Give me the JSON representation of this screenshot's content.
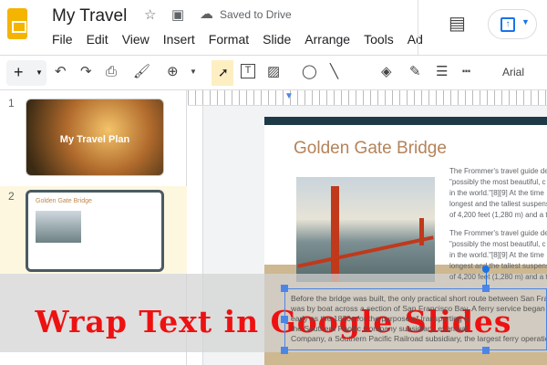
{
  "header": {
    "title": "My Travel",
    "saved_status": "Saved to Drive"
  },
  "menu": [
    "File",
    "Edit",
    "View",
    "Insert",
    "Format",
    "Slide",
    "Arrange",
    "Tools",
    "Ad"
  ],
  "toolbar": {
    "font": "Arial"
  },
  "slides_panel": {
    "items": [
      {
        "number": "1",
        "title": "My Travel Plan"
      },
      {
        "number": "2",
        "title": "Golden Gate Bridge"
      }
    ]
  },
  "slide": {
    "title": "Golden Gate Bridge",
    "para1": [
      "The Frommer's travel guide de",
      "\"possibly the most beautiful, c",
      "in the world.\"[8][9] At the time",
      "longest and the tallest suspens",
      "of 4,200 feet (1,280 m) and a t"
    ],
    "para2": [
      "The Frommer's travel guide de",
      "\"possibly the most beautiful, c",
      "in the world.\"[8][9] At the time",
      "longest and the tallest suspens",
      "of 4,200 feet (1,280 m) and a t"
    ],
    "textbox": [
      "Before the bridge was built, the only practical short route between San Fra",
      "was by boat across a section of San Francisco Bay. A ferry service began as",
      "early as the 1820s for the purpose of transporting w",
      "the Southern Pacific Company subsidiary, eventual",
      "Company, a Southern Pacific Railroad subsidiary, the largest ferry operation"
    ]
  },
  "banner": "Wrap Text in Google Slides",
  "colors": {
    "accent": "#1a73e8",
    "banner": "#ee1111",
    "title": "#b4835a"
  }
}
